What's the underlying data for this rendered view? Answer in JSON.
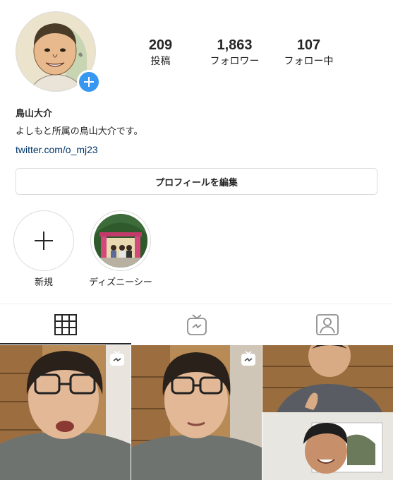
{
  "profile": {
    "name": "鳥山大介",
    "bio": "よしもと所属の鳥山大介です。",
    "link": "twitter.com/o_mj23"
  },
  "stats": [
    {
      "value": "209",
      "label": "投稿"
    },
    {
      "value": "1,863",
      "label": "フォロワー"
    },
    {
      "value": "107",
      "label": "フォロー中"
    }
  ],
  "edit_profile_label": "プロフィールを編集",
  "highlights": [
    {
      "label": "新規",
      "icon": "plus-icon"
    },
    {
      "label": "ディズニーシー",
      "icon": "photo-thumbnail"
    }
  ],
  "tabs": [
    {
      "name": "grid",
      "icon": "grid-icon",
      "active": true
    },
    {
      "name": "igtv",
      "icon": "tv-icon",
      "active": false
    },
    {
      "name": "tagged",
      "icon": "tagged-person-icon",
      "active": false
    }
  ],
  "colors": {
    "accent": "#3897f0",
    "link": "#003569",
    "text": "#262626",
    "border": "#dbdbdb"
  }
}
